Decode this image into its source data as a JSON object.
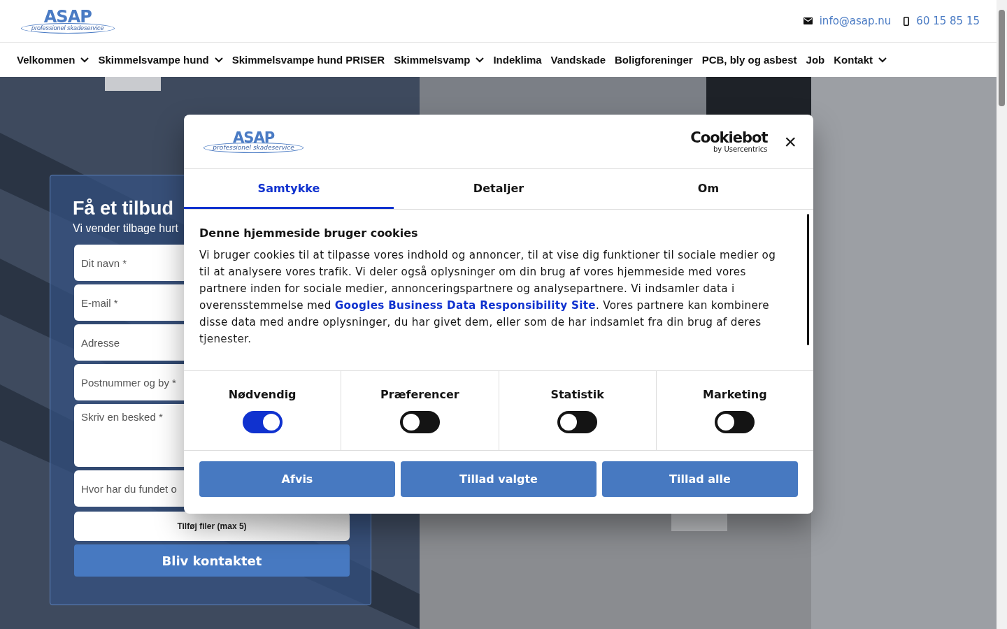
{
  "header": {
    "logo": {
      "name": "ASAP",
      "tagline": "professionel skadeservice"
    },
    "contacts": [
      {
        "kind": "email",
        "text": "info@asap.nu"
      },
      {
        "kind": "phone",
        "text": "60 15 85 15"
      }
    ]
  },
  "nav": [
    {
      "label": "Velkommen",
      "has_menu": true
    },
    {
      "label": "Skimmelsvampe hund",
      "has_menu": true
    },
    {
      "label": "Skimmelsvampe hund PRISER",
      "has_menu": false
    },
    {
      "label": "Skimmelsvamp",
      "has_menu": true
    },
    {
      "label": "Indeklima",
      "has_menu": false
    },
    {
      "label": "Vandskade",
      "has_menu": false
    },
    {
      "label": "Boligforeninger",
      "has_menu": false
    },
    {
      "label": "PCB, bly og asbest",
      "has_menu": false
    },
    {
      "label": "Job",
      "has_menu": false
    },
    {
      "label": "Kontakt",
      "has_menu": true
    }
  ],
  "quote_form": {
    "title": "Få et tilbud",
    "subtitle": "Vi vender tilbage hurt",
    "fields": [
      {
        "kind": "input",
        "placeholder": "Dit navn *"
      },
      {
        "kind": "input",
        "placeholder": "E-mail *"
      },
      {
        "kind": "input",
        "placeholder": "Adresse"
      },
      {
        "kind": "input",
        "placeholder": "Postnummer og by *"
      },
      {
        "kind": "textarea",
        "placeholder": "Skriv en besked *"
      },
      {
        "kind": "input",
        "placeholder": "Hvor har du fundet o"
      }
    ],
    "file_button": "Tilføj filer (max 5)",
    "submit": "Bliv kontaktet"
  },
  "cookie_dialog": {
    "logo": {
      "name": "ASAP",
      "tagline": "professionel skadeservice"
    },
    "brand": {
      "name": "Cookiebot",
      "sub": "by Usercentrics"
    },
    "close": "×",
    "tabs": [
      {
        "label": "Samtykke",
        "selected": true
      },
      {
        "label": "Detaljer",
        "selected": false
      },
      {
        "label": "Om",
        "selected": false
      }
    ],
    "heading": "Denne hjemmeside bruger cookies",
    "paragraph": "Vi bruger cookies til at tilpasse vores indhold og annoncer, til at vise dig funktioner til sociale medier og til at analysere vores trafik. Vi deler også oplysninger om din brug af vores hjemmeside med vores partnere inden for sociale medier, annonceringspartnere og analysepartnere. Vi indsamler data i overensstemmelse med ",
    "link": "Googles Business Data Responsibility Site",
    "paragraph_end": ". Vores partnere kan kombinere disse data med andre oplysninger, du har givet dem, eller som de har indsamlet fra din brug af deres tjenester.",
    "categories": [
      {
        "label": "Nødvendig",
        "on": true
      },
      {
        "label": "Præferencer",
        "on": false
      },
      {
        "label": "Statistik",
        "on": false
      },
      {
        "label": "Marketing",
        "on": false
      }
    ],
    "buttons": [
      "Afvis",
      "Tillad valgte",
      "Tillad alle"
    ]
  }
}
